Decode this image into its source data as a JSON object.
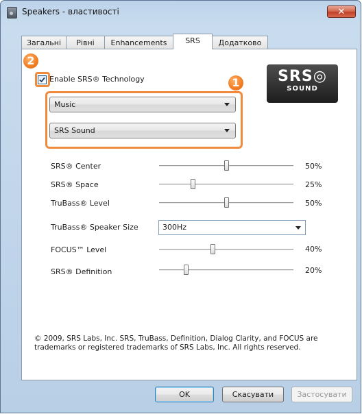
{
  "window": {
    "title": "Speakers - властивості",
    "close_glyph": "✕"
  },
  "tabs": [
    {
      "label": "Загальні",
      "active": false
    },
    {
      "label": "Рівні",
      "active": false
    },
    {
      "label": "Enhancements",
      "active": false
    },
    {
      "label": "SRS",
      "active": true
    },
    {
      "label": "Додатково",
      "active": false
    }
  ],
  "srs": {
    "enable_label": "Enable SRS® Technology",
    "enable_checked": true,
    "logo_main": "SRS◎",
    "logo_sub": "SOUND",
    "mode_selected": "Music",
    "preset_selected": "SRS Sound"
  },
  "annotations": {
    "badge_1": "1",
    "badge_2": "2",
    "highlight_color": "#f08a3c"
  },
  "settings": {
    "center": {
      "label": "SRS® Center",
      "value": 50,
      "value_text": "50%"
    },
    "space": {
      "label": "SRS® Space",
      "value": 25,
      "value_text": "25%"
    },
    "trubass": {
      "label": "TruBass® Level",
      "value": 50,
      "value_text": "50%"
    },
    "speaker_size": {
      "label": "TruBass® Speaker Size",
      "selected": "300Hz"
    },
    "focus": {
      "label": "FOCUS™ Level",
      "value": 40,
      "value_text": "40%"
    },
    "definition": {
      "label": "SRS® Definition",
      "value": 20,
      "value_text": "20%"
    }
  },
  "copyright": "© 2009, SRS Labs, Inc.  SRS, TruBass, Definition, Dialog Clarity, and FOCUS are trademarks or registered trademarks of SRS Labs, Inc.  All rights reserved.",
  "buttons": {
    "ok": "OK",
    "cancel": "Скасувати",
    "apply": "Застосувати"
  }
}
